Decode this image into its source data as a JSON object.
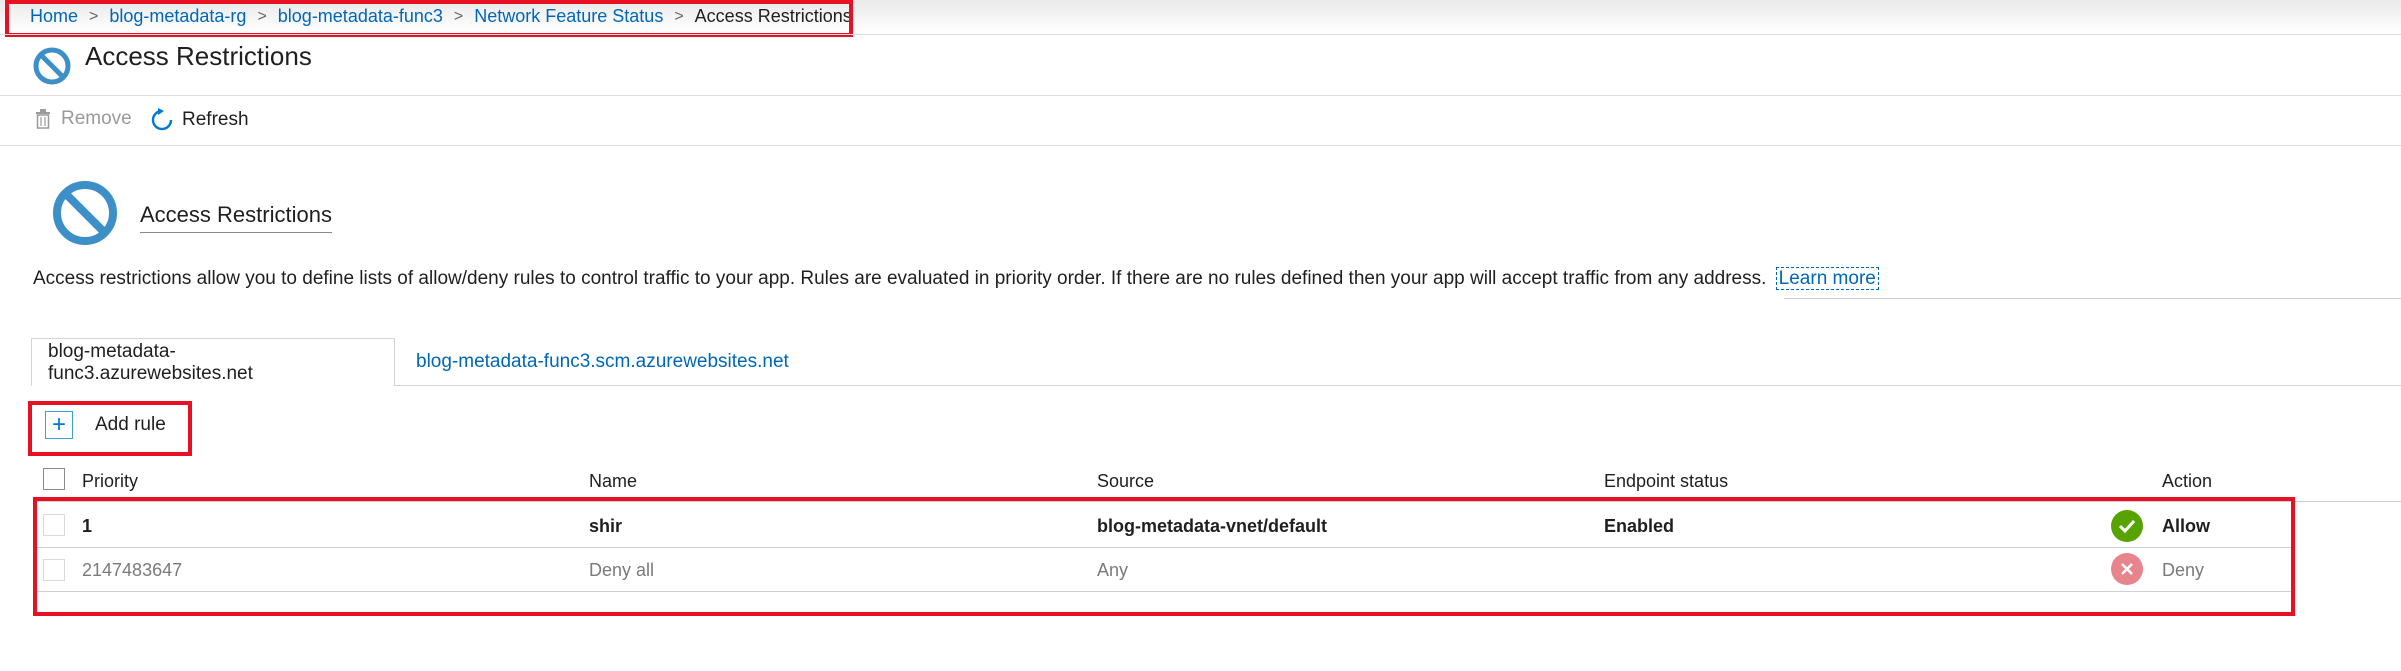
{
  "breadcrumb": {
    "items": [
      "Home",
      "blog-metadata-rg",
      "blog-metadata-func3",
      "Network Feature Status"
    ],
    "current": "Access Restrictions"
  },
  "page": {
    "title": "Access Restrictions",
    "icon": "blocked-circle-icon"
  },
  "toolbar": {
    "remove_label": "Remove",
    "refresh_label": "Refresh"
  },
  "section": {
    "title": "Access Restrictions",
    "description": "Access restrictions allow you to define lists of allow/deny rules to control traffic to your app. Rules are evaluated in priority order. If there are no rules defined then your app will accept traffic from any address.",
    "learn_more": "Learn more"
  },
  "tabs": [
    {
      "label": "blog-metadata-func3.azurewebsites.net",
      "active": true
    },
    {
      "label": "blog-metadata-func3.scm.azurewebsites.net",
      "active": false
    }
  ],
  "add_rule_label": "Add rule",
  "table": {
    "columns": [
      "Priority",
      "Name",
      "Source",
      "Endpoint status",
      "Action"
    ],
    "rows": [
      {
        "priority": "1",
        "name": "shir",
        "source": "blog-metadata-vnet/default",
        "endpoint_status": "Enabled",
        "action": "Allow",
        "action_icon": "check-circle-icon"
      },
      {
        "priority": "2147483647",
        "name": "Deny all",
        "source": "Any",
        "endpoint_status": "",
        "action": "Deny",
        "action_icon": "x-circle-icon"
      }
    ]
  },
  "colors": {
    "link": "#0067b8",
    "highlight": "#e81123",
    "allow": "#57a300",
    "deny": "#e8848b",
    "icon_blue": "#3d8fc7"
  }
}
